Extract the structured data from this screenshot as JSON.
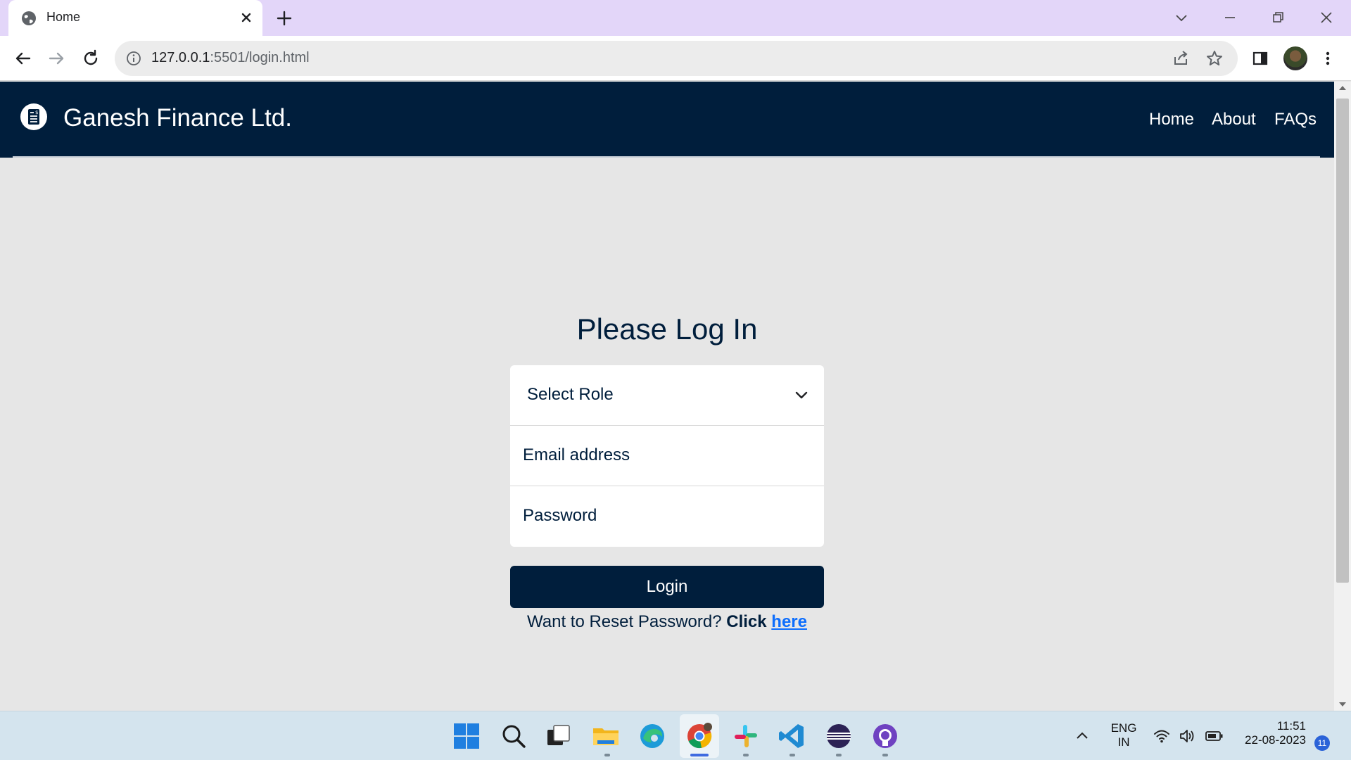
{
  "browser": {
    "tab_title": "Home",
    "url_host": "127.0.0.1",
    "url_path": ":5501/login.html"
  },
  "site": {
    "brand": "Ganesh Finance Ltd.",
    "nav": [
      "Home",
      "About",
      "FAQs"
    ],
    "colors": {
      "navy": "#001e3c",
      "link": "#0d6efd",
      "page_bg": "#e6e6e6"
    }
  },
  "login": {
    "title": "Please Log In",
    "role_select_value": "Select Role",
    "email_placeholder": "Email address",
    "password_placeholder": "Password",
    "submit_label": "Login",
    "reset_text": "Want to Reset Password?",
    "reset_click": "Click",
    "reset_link": "here"
  },
  "taskbar": {
    "apps": [
      "start-icon",
      "search-icon",
      "task-view-icon",
      "file-explorer-icon",
      "edge-icon",
      "chrome-icon",
      "slack-icon",
      "vscode-icon",
      "eclipse-icon",
      "github-desktop-icon"
    ],
    "lang_line1": "ENG",
    "lang_line2": "IN",
    "time": "11:51",
    "date": "22-08-2023",
    "notification_count": "11"
  }
}
